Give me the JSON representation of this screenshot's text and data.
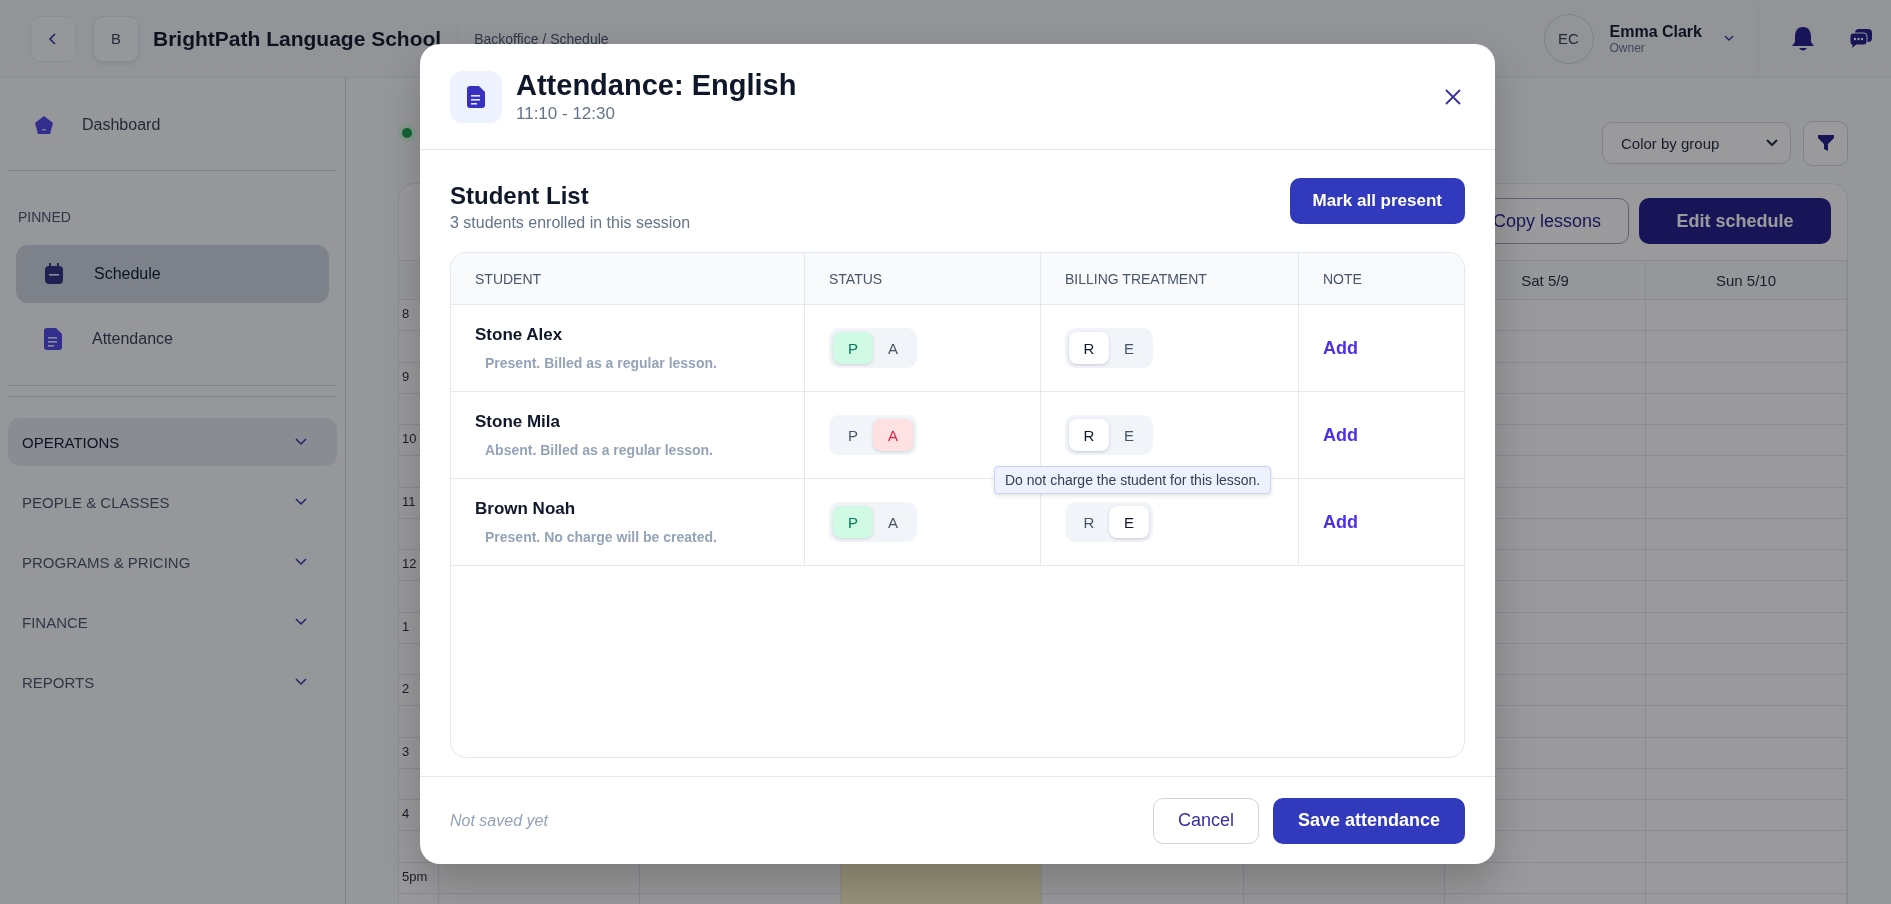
{
  "app": {
    "school_initial": "B",
    "school_name": "BrightPath Language School",
    "breadcrumb": "Backoffice / Schedule",
    "user": {
      "initials": "EC",
      "name": "Emma Clark",
      "role": "Owner"
    }
  },
  "sidebar": {
    "top_items": [
      {
        "label": "Dashboard",
        "selected": false
      }
    ],
    "pinned_heading": "PINNED",
    "pinned": [
      {
        "label": "Schedule",
        "selected": true,
        "kind": "calendar"
      },
      {
        "label": "Attendance",
        "selected": false,
        "kind": "document"
      }
    ],
    "sections": [
      {
        "label": "OPERATIONS",
        "selected": true,
        "expanded": false
      },
      {
        "label": "PEOPLE & CLASSES",
        "selected": false,
        "expanded": false
      },
      {
        "label": "PROGRAMS & PRICING",
        "selected": false,
        "expanded": false
      },
      {
        "label": "FINANCE",
        "selected": false,
        "expanded": false
      },
      {
        "label": "REPORTS",
        "selected": false,
        "expanded": false
      }
    ]
  },
  "toolbar": {
    "color_select": "Color by group",
    "buttons": [
      {
        "label": "Copy lessons",
        "kind": "secondary"
      },
      {
        "label": "Edit schedule",
        "kind": "primary"
      }
    ]
  },
  "calendar": {
    "day_headers": [
      "Sat 5/9",
      "Sun 5/10"
    ],
    "hours": [
      "8",
      "9",
      "10",
      "11",
      "12",
      "1",
      "2",
      "3",
      "4",
      "5pm"
    ]
  },
  "modal": {
    "title": "Attendance: English",
    "time": "11:10 - 12:30",
    "section_title": "Student List",
    "section_subtitle": "3 students enrolled in this session",
    "mark_all_button": "Mark all present",
    "columns": [
      "STUDENT",
      "STATUS",
      "BILLING TREATMENT",
      "NOTE"
    ],
    "students": [
      {
        "name": "Stone Alex",
        "summary": "Present. Billed as a regular lesson.",
        "status_options": [
          {
            "label": "P",
            "kind": "present",
            "selected": true
          },
          {
            "label": "A",
            "kind": "absent",
            "selected": false
          }
        ],
        "billing_options": [
          {
            "label": "R",
            "selected": true
          },
          {
            "label": "E",
            "selected": false
          }
        ],
        "note_action": "Add"
      },
      {
        "name": "Stone Mila",
        "summary": "Absent. Billed as a regular lesson.",
        "status_options": [
          {
            "label": "P",
            "kind": "present",
            "selected": false
          },
          {
            "label": "A",
            "kind": "absent",
            "selected": true
          }
        ],
        "billing_options": [
          {
            "label": "R",
            "selected": true
          },
          {
            "label": "E",
            "selected": false
          }
        ],
        "note_action": "Add"
      },
      {
        "name": "Brown Noah",
        "summary": "Present. No charge will be created.",
        "status_options": [
          {
            "label": "P",
            "kind": "present",
            "selected": true
          },
          {
            "label": "A",
            "kind": "absent",
            "selected": false
          }
        ],
        "billing_options": [
          {
            "label": "R",
            "selected": false
          },
          {
            "label": "E",
            "selected": true
          }
        ],
        "note_action": "Add",
        "tooltip": "Do not charge the student for this lesson."
      }
    ],
    "footer_status": "Not saved yet",
    "cancel_button": "Cancel",
    "save_button": "Save attendance"
  }
}
